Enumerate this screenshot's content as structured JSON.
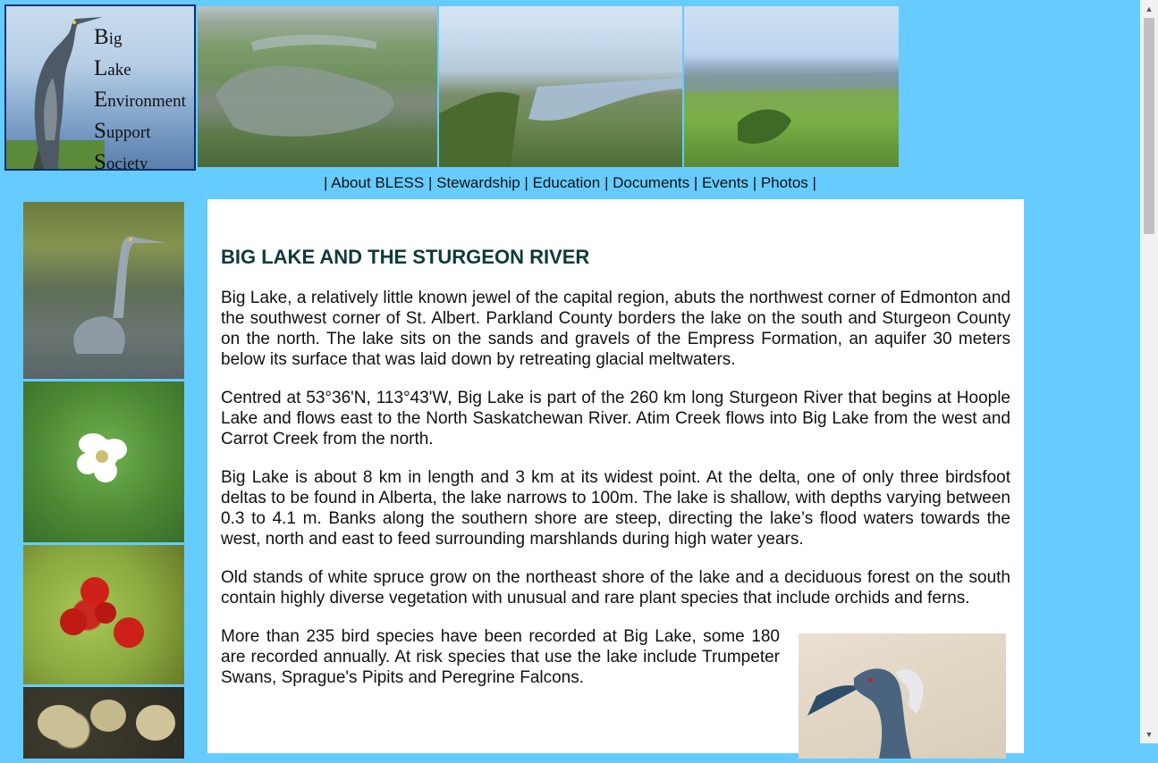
{
  "logo": {
    "lines": [
      {
        "cap": "B",
        "rest": "ig"
      },
      {
        "cap": "L",
        "rest": "ake"
      },
      {
        "cap": "E",
        "rest": "nvironment"
      },
      {
        "cap": "S",
        "rest": "upport"
      },
      {
        "cap": "S",
        "rest": "ociety"
      }
    ]
  },
  "nav": {
    "sep": "|",
    "items": [
      "About BLESS",
      "Stewardship",
      "Education",
      "Documents",
      "Events",
      "Photos"
    ]
  },
  "main": {
    "title": "BIG LAKE AND THE STURGEON RIVER",
    "paragraphs": [
      "Big Lake, a relatively little known jewel of the capital region, abuts the northwest corner of Edmonton and the southwest corner of St. Albert. Parkland County borders the lake on the south and Sturgeon County on the north. The lake sits on the sands and gravels of the Empress Formation, an aquifer 30 meters below its surface that was laid down by retreating glacial meltwaters.",
      "Centred at 53°36'N, 113°43'W, Big Lake is part of the 260 km long Sturgeon River that begins at Hoople Lake and flows east to the North Saskatchewan River. Atim Creek flows into Big Lake from the west and Carrot Creek from the north.",
      "Big Lake is about 8 km in length and 3 km at its widest point. At the delta, one of only three birdsfoot deltas to be found in Alberta, the lake narrows to 100m. The lake is shallow, with depths varying between 0.3 to 4.1 m. Banks along the southern shore are steep, directing the lake’s flood waters towards the west, north and east to feed surrounding marshlands during high water years.",
      "Old stands of white spruce grow on the northeast shore of the lake and a deciduous forest on the south contain highly diverse vegetation with unusual and rare plant species that include orchids and ferns.",
      "More than 235 bird species have been recorded at Big Lake, some 180 are recorded annually. At risk species that use the lake include Trumpeter Swans, Sprague's Pipits and Peregrine Falcons."
    ]
  }
}
